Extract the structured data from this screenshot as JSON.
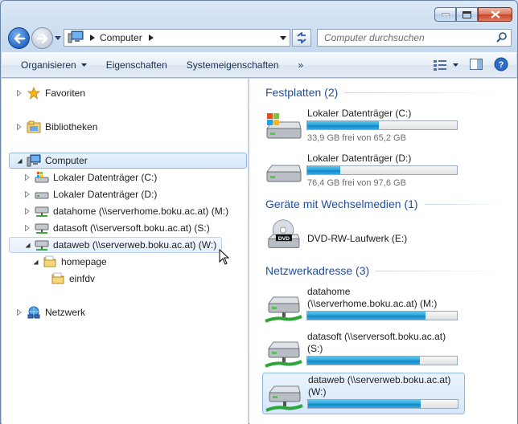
{
  "window": {
    "caption_buttons": [
      "minimize",
      "maximize",
      "close"
    ]
  },
  "address": {
    "crumb": "Computer"
  },
  "search": {
    "placeholder": "Computer durchsuchen"
  },
  "toolbar": {
    "organize_label": "Organisieren",
    "properties_label": "Eigenschaften",
    "system_properties_label": "Systemeigenschaften",
    "more_label": "»"
  },
  "nav": {
    "favorites": "Favoriten",
    "libraries": "Bibliotheken",
    "computer": "Computer",
    "drive_c": "Lokaler Datenträger (C:)",
    "drive_d": "Lokaler Datenträger (D:)",
    "datahome": "datahome (\\\\serverhome.boku.ac.at) (M:)",
    "datasoft": "datasoft (\\\\serversoft.boku.ac.at) (S:)",
    "dataweb": "dataweb (\\\\serverweb.boku.ac.at) (W:)",
    "homepage": "homepage",
    "einfdv": "einfdv",
    "network": "Netzwerk"
  },
  "groups": {
    "hard_disks": "Festplatten (2)",
    "removable": "Geräte mit Wechselmedien (1)",
    "network": "Netzwerkadresse (3)"
  },
  "drives": {
    "c": {
      "name": "Lokaler Datenträger (C:)",
      "free": "33,9 GB frei von 65,2 GB",
      "used_fraction": 0.48
    },
    "d": {
      "name": "Lokaler Datenträger (D:)",
      "free": "76,4 GB frei von 97,6 GB",
      "used_fraction": 0.22
    },
    "dvd": {
      "name": "DVD-RW-Laufwerk (E:)",
      "badge": "DVD"
    },
    "datahome": {
      "line1": "datahome",
      "line2": "(\\\\serverhome.boku.ac.at) (M:)",
      "used_fraction": 0.79
    },
    "datasoft": {
      "line1": "datasoft (\\\\serversoft.boku.ac.at)",
      "line2": "(S:)",
      "used_fraction": 0.75
    },
    "dataweb": {
      "line1": "dataweb (\\\\serverweb.boku.ac.at)",
      "line2": "(W:)",
      "used_fraction": 0.75
    }
  },
  "colors": {
    "accent": "#1f4e9b",
    "bar_fill": "#26a0da",
    "selection": "#d5e7fb"
  }
}
